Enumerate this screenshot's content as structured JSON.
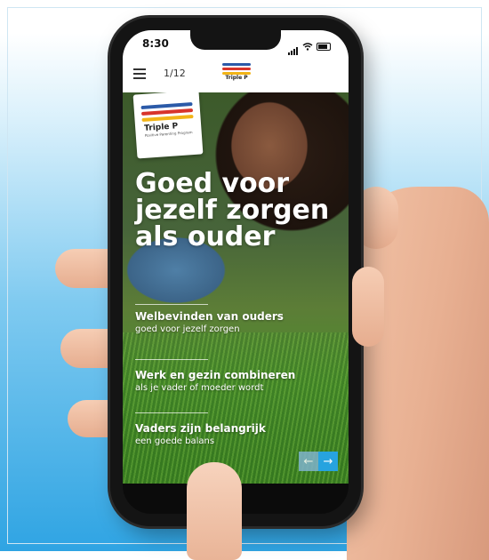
{
  "status_bar": {
    "time": "8:30"
  },
  "navbar": {
    "page_counter": "1/12",
    "logo_text": "Triple P"
  },
  "hero": {
    "logo": {
      "name": "Triple P",
      "tagline": "Positive Parenting Program"
    },
    "headline": "Goed voor jezelf zorgen als ouder",
    "links": [
      {
        "title": "Welbevinden van ouders",
        "subtitle": "goed voor jezelf zorgen"
      },
      {
        "title": "Werk en gezin combineren",
        "subtitle": "als je vader of moeder wordt"
      },
      {
        "title": "Vaders zijn belangrijk",
        "subtitle": "een goede balans"
      }
    ],
    "prev_arrow": "←",
    "next_arrow": "→"
  },
  "colors": {
    "logo_blue": "#2b5aa8",
    "logo_red": "#d8342b",
    "logo_yellow": "#f2b417",
    "accent": "#27a3df"
  },
  "icons": [
    "menu-icon",
    "signal-icon",
    "wifi-icon",
    "battery-icon",
    "arrow-left-icon",
    "arrow-right-icon"
  ]
}
